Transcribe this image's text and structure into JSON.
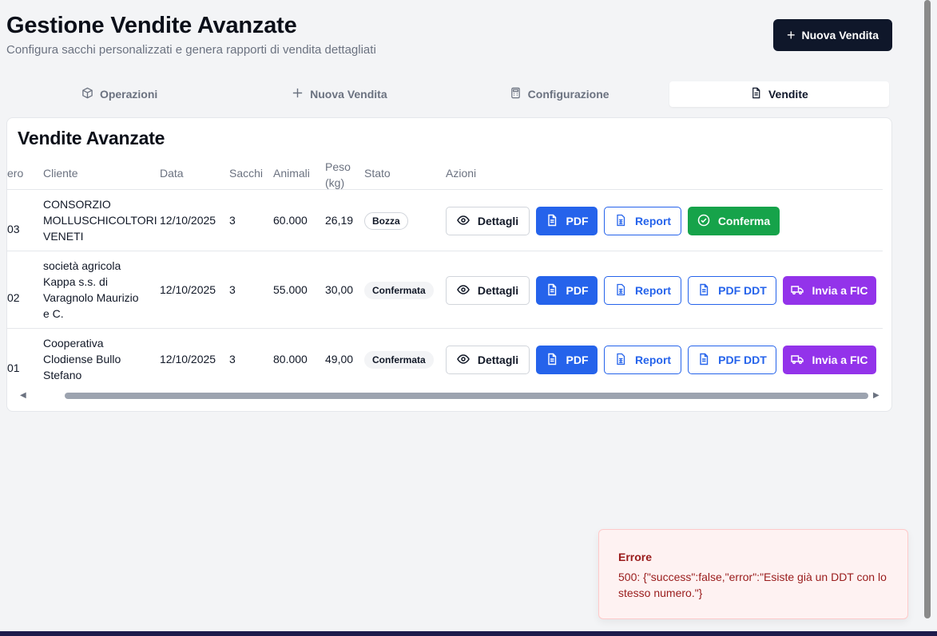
{
  "header": {
    "title": "Gestione Vendite Avanzate",
    "subtitle": "Configura sacchi personalizzati e genera rapporti di vendita dettagliati",
    "new_sale_button": "Nuova Vendita"
  },
  "tabs": [
    {
      "label": "Operazioni",
      "icon": "box-icon",
      "active": false
    },
    {
      "label": "Nuova Vendita",
      "icon": "plus-icon",
      "active": false
    },
    {
      "label": "Configurazione",
      "icon": "calculator-icon",
      "active": false
    },
    {
      "label": "Vendite",
      "icon": "document-icon",
      "active": true
    }
  ],
  "card": {
    "title": "Vendite Avanzate",
    "columns": [
      "ero",
      "Cliente",
      "Data",
      "Sacchi",
      "Animali",
      "Peso (kg)",
      "Stato",
      "Azioni"
    ],
    "rows": [
      {
        "numero": "03",
        "cliente": "CONSORZIO MOLLUSCHICOLTORI VENETI",
        "data": "12/10/2025",
        "sacchi": "3",
        "animali": "60.000",
        "peso": "26,19",
        "stato": "Bozza",
        "actions": [
          "Dettagli",
          "PDF",
          "Report",
          "Conferma"
        ]
      },
      {
        "numero": "02",
        "cliente": "società agricola Kappa s.s. di Varagnolo Maurizio e C.",
        "data": "12/10/2025",
        "sacchi": "3",
        "animali": "55.000",
        "peso": "30,00",
        "stato": "Confermata",
        "actions": [
          "Dettagli",
          "PDF",
          "Report",
          "PDF DDT",
          "Invia a FIC"
        ]
      },
      {
        "numero": "01",
        "cliente": "Cooperativa Clodiense Bullo Stefano",
        "data": "12/10/2025",
        "sacchi": "3",
        "animali": "80.000",
        "peso": "49,00",
        "stato": "Confermata",
        "actions": [
          "Dettagli",
          "PDF",
          "Report",
          "PDF DDT",
          "Invia a FIC"
        ]
      }
    ]
  },
  "toast": {
    "title": "Errore",
    "message": "500: {\"success\":false,\"error\":\"Esiste già un DDT con lo stesso numero.\"}"
  },
  "colors": {
    "primary": "#0f172a",
    "blue": "#2563eb",
    "green": "#16a34a",
    "purple": "#9333ea",
    "error_bg": "#fef2f2",
    "error_text": "#991b1b"
  }
}
